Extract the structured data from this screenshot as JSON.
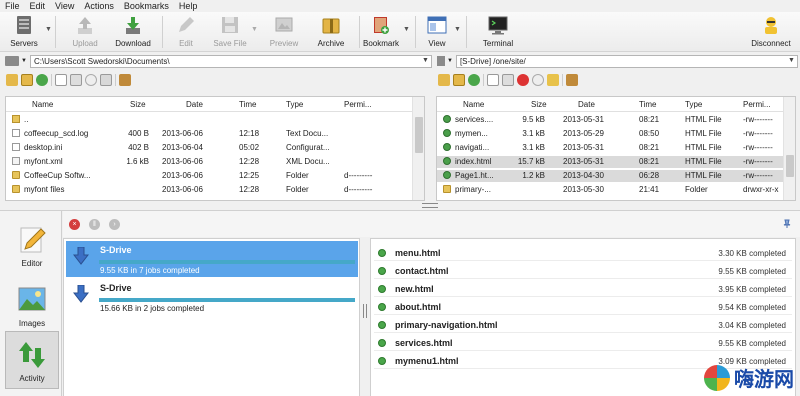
{
  "menu": [
    "File",
    "Edit",
    "View",
    "Actions",
    "Bookmarks",
    "Help"
  ],
  "toolbar": {
    "servers": "Servers",
    "upload": "Upload",
    "download": "Download",
    "edit": "Edit",
    "save_file": "Save File",
    "preview": "Preview",
    "archive": "Archive",
    "bookmark": "Bookmark",
    "view": "View",
    "terminal": "Terminal",
    "disconnect": "Disconnect"
  },
  "local_path": "C:\\Users\\Scott Swedorski\\Documents\\",
  "remote_path": "[S-Drive] /one/site/",
  "local_pane": {
    "headers": {
      "name": "Name",
      "size": "Size",
      "date": "Date",
      "time": "Time",
      "type": "Type",
      "perm": "Permi..."
    },
    "rows": [
      {
        "name": "..",
        "size": "",
        "date": "",
        "time": "",
        "type": "",
        "perm": "",
        "icon": "up-folder-icon"
      },
      {
        "name": "coffeecup_scd.log",
        "size": "400 B",
        "date": "2013-06-06",
        "time": "12:18",
        "type": "Text Docu...",
        "perm": "",
        "icon": "document-icon"
      },
      {
        "name": "desktop.ini",
        "size": "402 B",
        "date": "2013-06-04",
        "time": "05:02",
        "type": "Configurat...",
        "perm": "",
        "icon": "document-icon"
      },
      {
        "name": "myfont.xml",
        "size": "1.6 kB",
        "date": "2013-06-06",
        "time": "12:28",
        "type": "XML Docu...",
        "perm": "",
        "icon": "xml-file-icon"
      },
      {
        "name": "CoffeeCup Softw...",
        "size": "",
        "date": "2013-06-06",
        "time": "12:25",
        "type": "Folder",
        "perm": "d---------",
        "icon": "folder-icon"
      },
      {
        "name": "myfont files",
        "size": "",
        "date": "2013-06-06",
        "time": "12:28",
        "type": "Folder",
        "perm": "d---------",
        "icon": "folder-icon"
      }
    ]
  },
  "remote_pane": {
    "headers": {
      "name": "Name",
      "size": "Size",
      "date": "Date",
      "time": "Time",
      "type": "Type",
      "perm": "Permi..."
    },
    "rows": [
      {
        "name": "services....",
        "size": "9.5 kB",
        "date": "2013-05-31",
        "time": "08:21",
        "type": "HTML File",
        "perm": "-rw-------",
        "icon": "globe-file-icon"
      },
      {
        "name": "mymen...",
        "size": "3.1 kB",
        "date": "2013-05-29",
        "time": "08:50",
        "type": "HTML File",
        "perm": "-rw-------",
        "icon": "globe-file-icon"
      },
      {
        "name": "navigati...",
        "size": "3.1 kB",
        "date": "2013-05-31",
        "time": "08:21",
        "type": "HTML File",
        "perm": "-rw-------",
        "icon": "globe-file-icon"
      },
      {
        "name": "index.html",
        "size": "15.7 kB",
        "date": "2013-05-31",
        "time": "08:21",
        "type": "HTML File",
        "perm": "-rw-------",
        "icon": "globe-file-icon"
      },
      {
        "name": "Page1.ht...",
        "size": "1.2 kB",
        "date": "2013-04-30",
        "time": "06:28",
        "type": "HTML File",
        "perm": "-rw-------",
        "icon": "globe-file-icon"
      },
      {
        "name": "primary-...",
        "size": "",
        "date": "2013-05-30",
        "time": "21:41",
        "type": "Folder",
        "perm": "drwxr-xr-x",
        "icon": "folder-icon"
      }
    ]
  },
  "sidebar": {
    "editor": "Editor",
    "images": "Images",
    "activity": "Activity"
  },
  "jobs": [
    {
      "name": "S-Drive",
      "status": "9.55 KB in 7 jobs completed",
      "progress": 1.0
    },
    {
      "name": "S-Drive",
      "status": "15.66 KB in 2 jobs completed",
      "progress": 1.0
    }
  ],
  "completed_files": [
    {
      "name": "menu.html",
      "status": "3.30 KB completed"
    },
    {
      "name": "contact.html",
      "status": "9.55 KB completed"
    },
    {
      "name": "new.html",
      "status": "3.95 KB completed"
    },
    {
      "name": "about.html",
      "status": "9.54 KB completed"
    },
    {
      "name": "primary-navigation.html",
      "status": "3.04 KB completed"
    },
    {
      "name": "services.html",
      "status": "9.55 KB completed"
    },
    {
      "name": "mymenu1.html",
      "status": "3.09 KB completed"
    }
  ],
  "watermark": "嗨游网",
  "colors": {
    "selection": "#5aa4ea",
    "progress": "#45a8c8",
    "status_ok": "#4aa64a"
  }
}
